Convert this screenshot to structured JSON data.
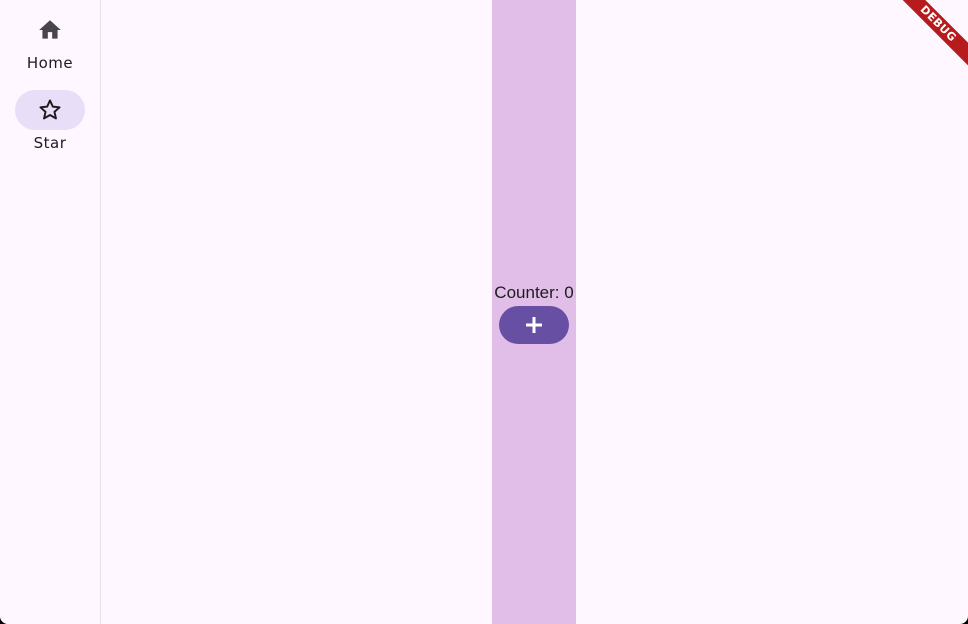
{
  "rail": {
    "destinations": [
      {
        "label": "Home",
        "icon": "home-icon",
        "selected": false
      },
      {
        "label": "Star",
        "icon": "star-icon",
        "selected": true
      }
    ]
  },
  "main": {
    "counter_text": "Counter: 0",
    "increment_icon": "plus-icon",
    "column_color": "#e1bee7",
    "fab_color": "#6750a4"
  },
  "debug_banner": {
    "label": "DEBUG",
    "color": "#b71c1c"
  }
}
